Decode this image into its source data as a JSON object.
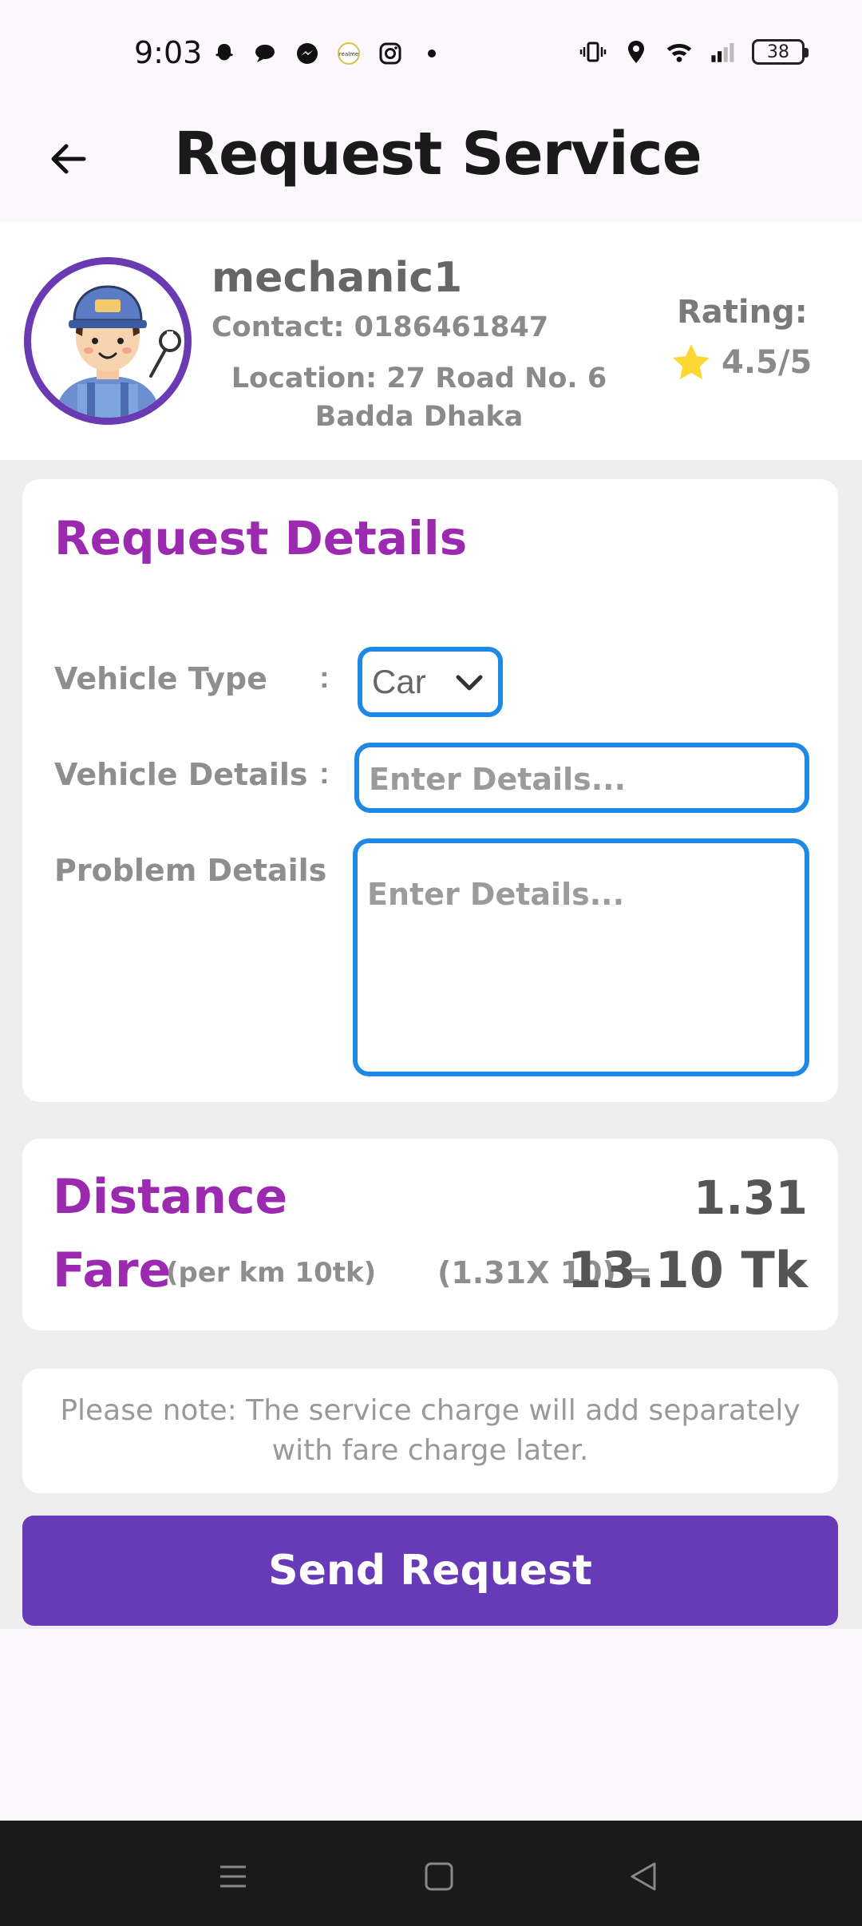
{
  "status_bar": {
    "time": "9:03",
    "battery": "38",
    "left_icons": [
      "snapchat-icon",
      "chat-bubble-icon",
      "messenger-icon",
      "realme-icon",
      "instagram-icon",
      "dot-icon"
    ],
    "right_icons": [
      "vibrate-icon",
      "location-icon",
      "wifi-icon",
      "signal-icon",
      "battery-icon"
    ]
  },
  "app_bar": {
    "title": "Request Service",
    "back_icon": "arrow-left-icon"
  },
  "mechanic": {
    "name": "mechanic1",
    "contact": "Contact: 0186461847",
    "location": "Location: 27 Road No. 6 Badda Dhaka",
    "rating_label": "Rating:",
    "rating_value": "4.5/5",
    "rating": 4.5,
    "avatar_icon": "mechanic-avatar-icon"
  },
  "request_details": {
    "title": "Request Details",
    "vehicle_type_label": "Vehicle Type",
    "vehicle_type_value": "Car",
    "vehicle_details_label": "Vehicle Details",
    "vehicle_details_placeholder": "Enter Details...",
    "problem_details_label": "Problem Details",
    "problem_details_placeholder": "Enter Details...",
    "colon": ":"
  },
  "fare": {
    "distance_label": "Distance",
    "distance_value": "1.31",
    "fare_label": "Fare",
    "fare_rate": "(per km 10tk)",
    "fare_calc": "(1.31X 10) =",
    "fare_total": "13.10 Tk"
  },
  "note": {
    "text": "Please note: The service charge will add separately with fare charge later."
  },
  "actions": {
    "send_label": "Send Request"
  },
  "colors": {
    "accent_purple": "#9b2ab0",
    "button_purple": "#673ab7",
    "input_blue": "#1e88e5",
    "star_yellow": "#fdd835"
  }
}
